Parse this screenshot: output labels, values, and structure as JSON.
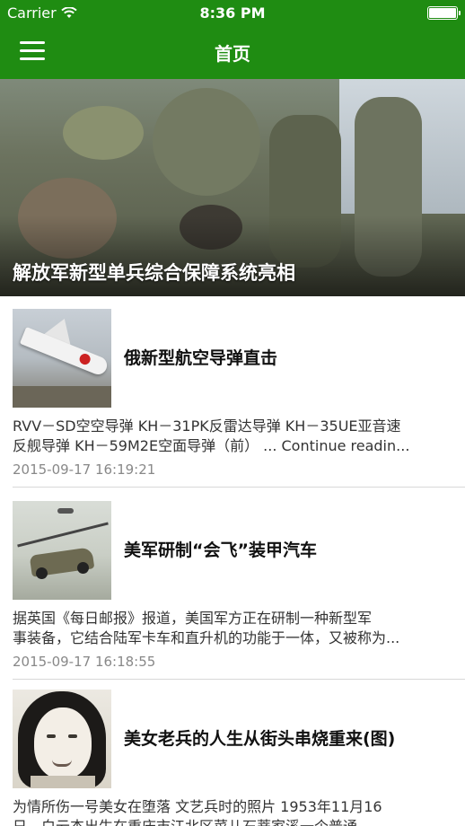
{
  "status_bar": {
    "carrier": "Carrier",
    "time": "8:36 PM"
  },
  "nav": {
    "title": "首页",
    "menu_icon": "hamburger-menu-icon",
    "color": "#1f8c12"
  },
  "banner": {
    "caption": "解放军新型单兵综合保障系统亮相"
  },
  "news": [
    {
      "title": "俄新型航空导弹直击",
      "summary_lines": [
        "RVV－SD空空导弹 KH－31PK反雷达导弹 KH－35UE亚音速",
        "反舰导弹 KH－59M2E空面导弹（前） ... Continue readin..."
      ],
      "date": "2015-09-17 16:19:21"
    },
    {
      "title": "美军研制“会飞”装甲汽车",
      "summary_lines": [
        "        据英国《每日邮报》报道，美国军方正在研制一种新型军",
        "事装备，它结合陆军卡车和直升机的功能于一体，又被称为..."
      ],
      "date": "2015-09-17 16:18:55"
    },
    {
      "title": "美女老兵的人生从街头串烧重来(图)",
      "summary_lines": [
        "    为情所伤一号美女在堕落 文艺兵时的照片 1953年11月16",
        "日，白云杰出生在重庆市江北区菜儿石蒂家溪一个普通..."
      ],
      "date": ""
    }
  ]
}
